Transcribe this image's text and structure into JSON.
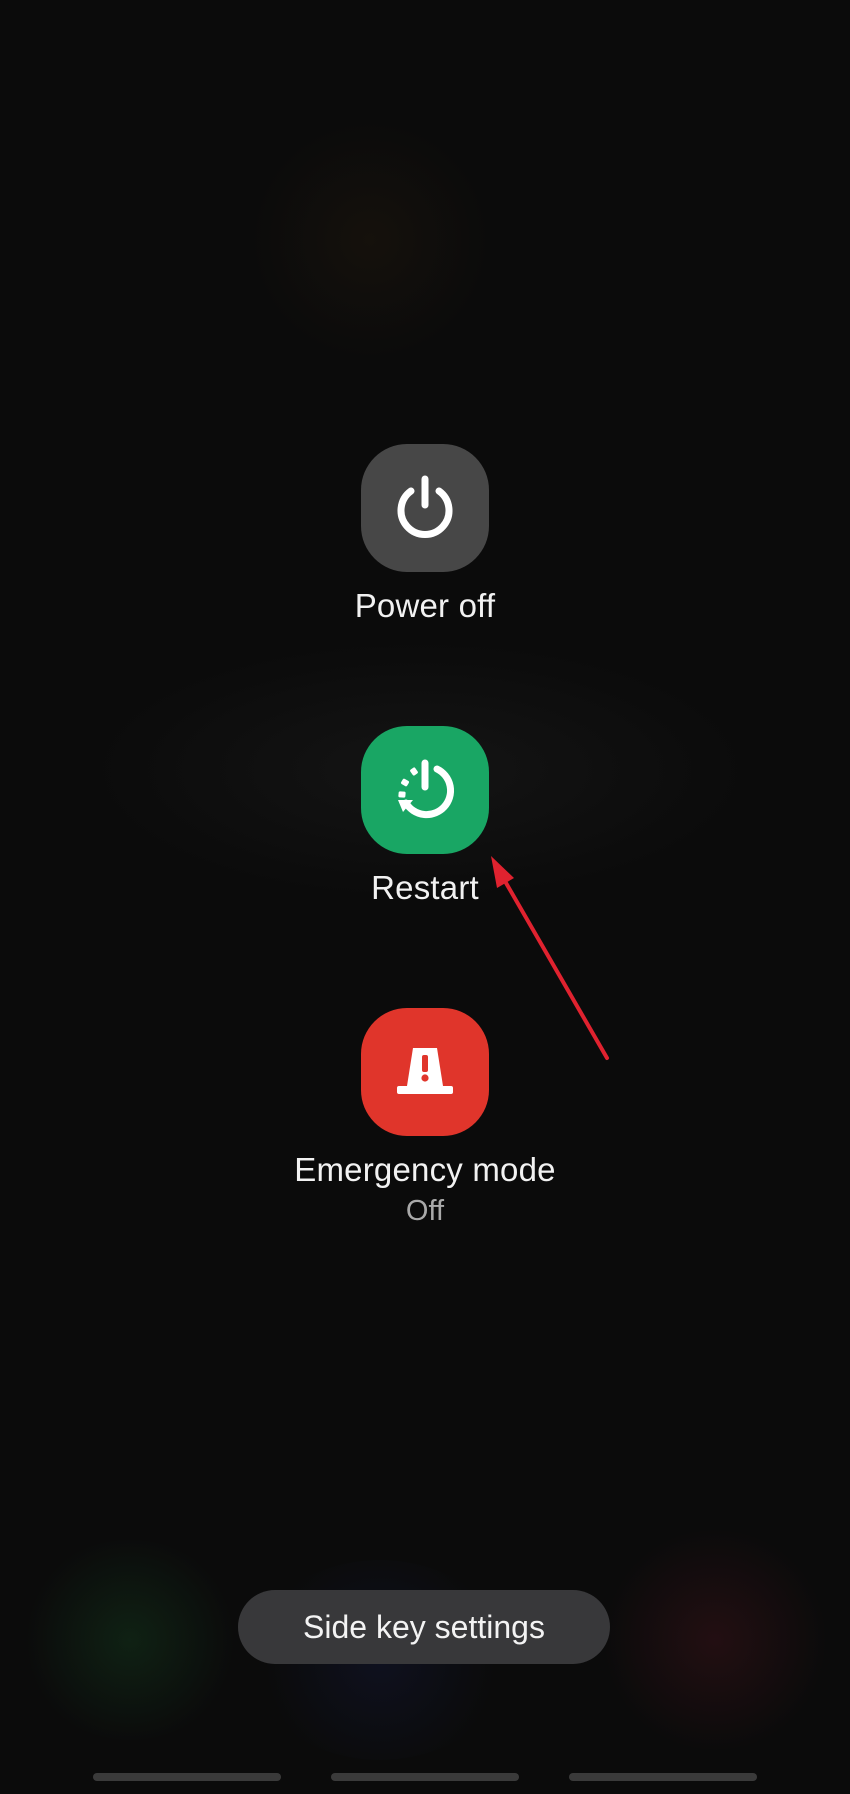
{
  "power_menu": {
    "power_off": {
      "label": "Power off",
      "icon": "power-icon",
      "color": "#474747"
    },
    "restart": {
      "label": "Restart",
      "icon": "restart-icon",
      "color": "#19a664"
    },
    "emergency_mode": {
      "label": "Emergency mode",
      "status": "Off",
      "icon": "emergency-siren-icon",
      "color": "#e0352b"
    }
  },
  "side_key_settings": {
    "label": "Side key settings"
  },
  "annotation": {
    "type": "arrow",
    "color": "#e0222f",
    "points_to": "restart"
  },
  "navigation_bar": {
    "handles": 3
  }
}
